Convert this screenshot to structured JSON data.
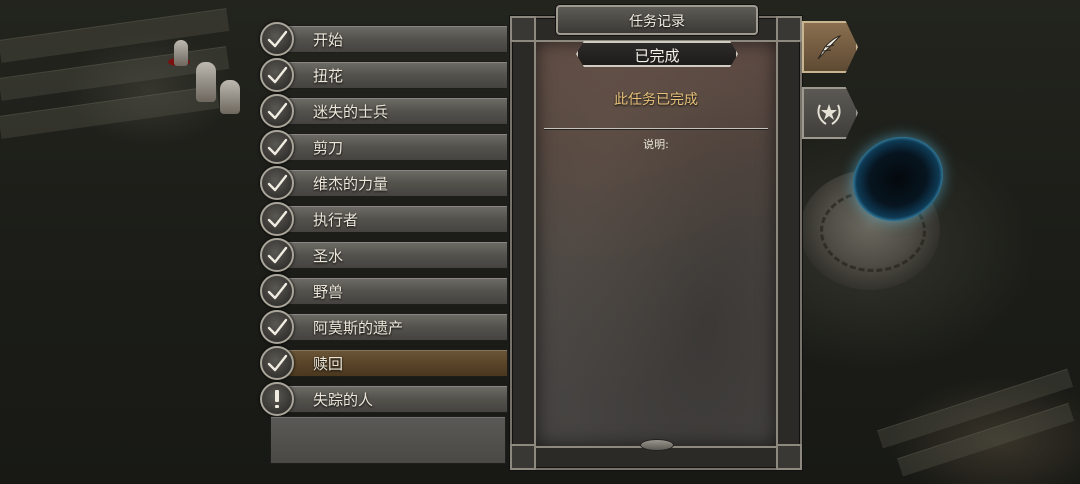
{
  "journal": {
    "title": "任务记录",
    "status": "已完成",
    "message": "此任务已完成",
    "description_label": "说明:",
    "description_text": "",
    "accent_color": "#e8c27a"
  },
  "quests": [
    {
      "label": "开始",
      "icon": "check-icon",
      "selected": false
    },
    {
      "label": "扭花",
      "icon": "check-icon",
      "selected": false
    },
    {
      "label": "迷失的士兵",
      "icon": "check-icon",
      "selected": false
    },
    {
      "label": "剪刀",
      "icon": "check-icon",
      "selected": false
    },
    {
      "label": "维杰的力量",
      "icon": "check-icon",
      "selected": false
    },
    {
      "label": "执行者",
      "icon": "check-icon",
      "selected": false
    },
    {
      "label": "圣水",
      "icon": "check-icon",
      "selected": false
    },
    {
      "label": "野兽",
      "icon": "check-icon",
      "selected": false
    },
    {
      "label": "阿莫斯的遗产",
      "icon": "check-icon",
      "selected": false
    },
    {
      "label": "赎回",
      "icon": "check-icon",
      "selected": true
    },
    {
      "label": "失踪的人",
      "icon": "exclamation-icon",
      "selected": false
    }
  ],
  "side_tabs": [
    {
      "icon": "quill-icon",
      "active": true
    },
    {
      "icon": "star-laurel-icon",
      "active": false
    }
  ]
}
